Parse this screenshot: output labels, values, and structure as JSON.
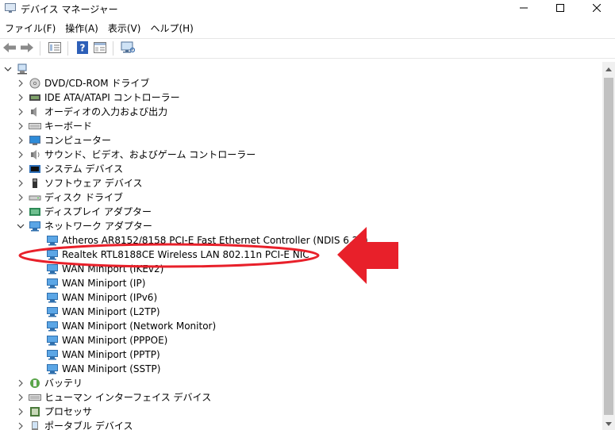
{
  "window": {
    "title": "デバイス マネージャー",
    "icons": {
      "app": "device-manager-icon",
      "minimize": "minimize-icon",
      "maximize": "maximize-icon",
      "close": "close-icon"
    }
  },
  "menu": [
    "ファイル(F)",
    "操作(A)",
    "表示(V)",
    "ヘルプ(H)"
  ],
  "toolbar": {
    "buttons": [
      "back-arrow-icon",
      "forward-arrow-icon",
      "properties-icon",
      "help-icon",
      "console-tree-icon",
      "monitor-icon"
    ]
  },
  "tree": {
    "categories": [
      {
        "label": "DVD/CD-ROM ドライブ",
        "icon": "dvd-drive-icon"
      },
      {
        "label": "IDE ATA/ATAPI コントローラー",
        "icon": "ide-controller-icon"
      },
      {
        "label": "オーディオの入力および出力",
        "icon": "speaker-icon"
      },
      {
        "label": "キーボード",
        "icon": "keyboard-icon"
      },
      {
        "label": "コンピューター",
        "icon": "computer-icon"
      },
      {
        "label": "サウンド、ビデオ、およびゲーム コントローラー",
        "icon": "sound-icon"
      },
      {
        "label": "システム デバイス",
        "icon": "system-device-icon"
      },
      {
        "label": "ソフトウェア デバイス",
        "icon": "software-device-icon"
      },
      {
        "label": "ディスク ドライブ",
        "icon": "disk-drive-icon"
      },
      {
        "label": "ディスプレイ アダプター",
        "icon": "display-adapter-icon"
      }
    ],
    "network": {
      "label": "ネットワーク アダプター",
      "icon": "network-adapter-icon",
      "children": [
        "Atheros AR8152/8158 PCI-E Fast Ethernet Controller (NDIS 6.20)",
        "Realtek RTL8188CE Wireless LAN 802.11n PCI-E NIC",
        "WAN Miniport (IKEv2)",
        "WAN Miniport (IP)",
        "WAN Miniport (IPv6)",
        "WAN Miniport (L2TP)",
        "WAN Miniport (Network Monitor)",
        "WAN Miniport (PPPOE)",
        "WAN Miniport (PPTP)",
        "WAN Miniport (SSTP)"
      ]
    },
    "after": [
      {
        "label": "バッテリ",
        "icon": "battery-icon"
      },
      {
        "label": "ヒューマン インターフェイス デバイス",
        "icon": "hid-icon"
      },
      {
        "label": "プロセッサ",
        "icon": "processor-icon"
      },
      {
        "label": "ポータブル デバイス",
        "icon": "portable-device-icon"
      }
    ]
  },
  "annotation": {
    "highlight_color": "#e8202a",
    "arrow_color": "#e8202a"
  }
}
